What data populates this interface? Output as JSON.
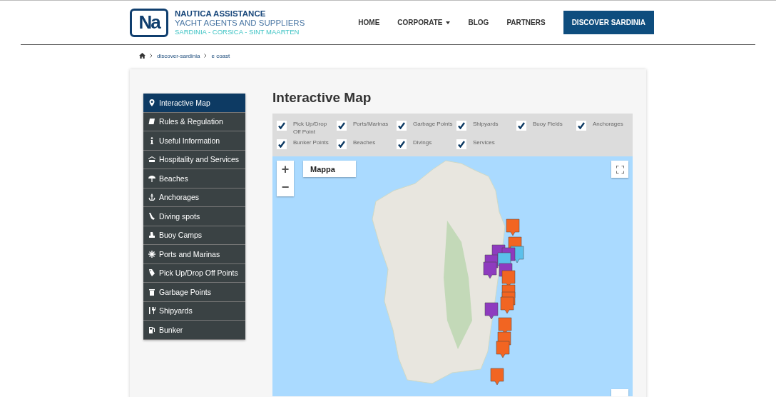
{
  "header": {
    "logo": {
      "mark": "Na",
      "title": "NAUTICA ASSISTANCE",
      "subtitle": "YACHT AGENTS AND SUPPLIERS",
      "regions": "SARDINIA - CORSICA - SINT MAARTEN"
    },
    "nav": [
      {
        "label": "HOME",
        "kind": "link"
      },
      {
        "label": "CORPORATE",
        "kind": "dropdown"
      },
      {
        "label": "BLOG",
        "kind": "link"
      },
      {
        "label": "PARTNERS",
        "kind": "link"
      },
      {
        "label": "DISCOVER SARDINIA",
        "kind": "button"
      }
    ]
  },
  "breadcrumb": [
    "discover-sardinia",
    "e coast"
  ],
  "sidebar": {
    "items": [
      {
        "label": "Interactive Map",
        "selected": true
      },
      {
        "label": "Rules & Regulation",
        "selected": false
      },
      {
        "label": "Useful Information",
        "selected": false
      },
      {
        "label": "Hospitality and Services",
        "selected": false
      },
      {
        "label": "Beaches",
        "selected": false
      },
      {
        "label": "Anchorages",
        "selected": false
      },
      {
        "label": "Diving spots",
        "selected": false
      },
      {
        "label": "Buoy Camps",
        "selected": false
      },
      {
        "label": "Ports and Marinas",
        "selected": false
      },
      {
        "label": "Pick Up/Drop Off Points",
        "selected": false
      },
      {
        "label": "Garbage Points",
        "selected": false
      },
      {
        "label": "Shipyards",
        "selected": false
      },
      {
        "label": "Bunker",
        "selected": false
      }
    ]
  },
  "main": {
    "title": "Interactive Map",
    "filters": [
      {
        "label": "Pick Up/Drop Off Point",
        "checked": true
      },
      {
        "label": "Ports/Marinas",
        "checked": true
      },
      {
        "label": "Garbage Points",
        "checked": true
      },
      {
        "label": "Shipyards",
        "checked": true
      },
      {
        "label": "Buoy Fields",
        "checked": true
      },
      {
        "label": "Anchorages",
        "checked": true
      },
      {
        "label": "Bunker Points",
        "checked": true
      },
      {
        "label": "Beaches",
        "checked": true
      },
      {
        "label": "Divings",
        "checked": true
      },
      {
        "label": "Services",
        "checked": true
      }
    ],
    "map": {
      "zoom_in": "+",
      "zoom_out": "−",
      "map_type": "Mappa"
    }
  }
}
